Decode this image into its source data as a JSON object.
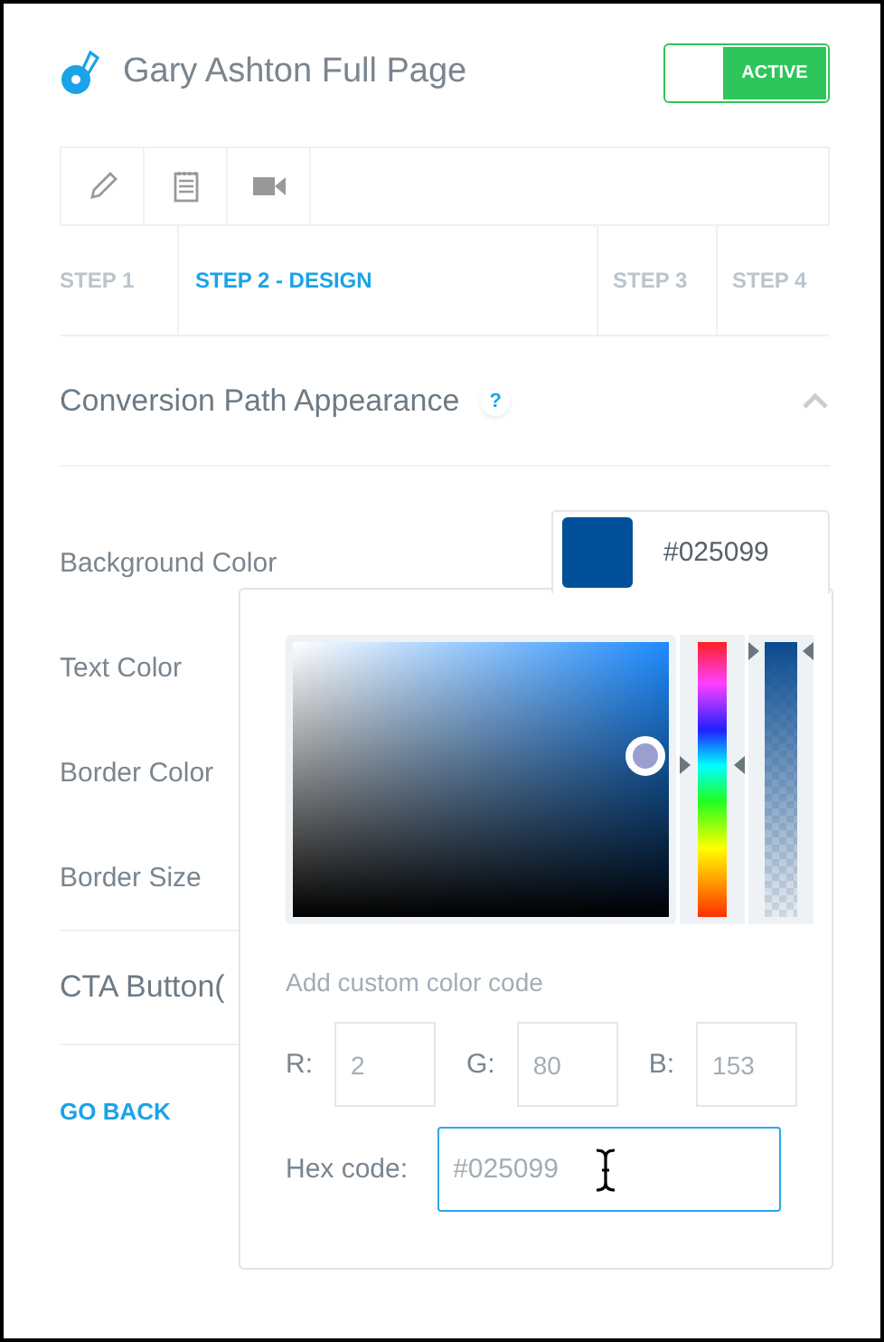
{
  "header": {
    "title": "Gary Ashton Full Page",
    "toggle": {
      "label": "ACTIVE",
      "on": true
    }
  },
  "toolbar": [
    {
      "kind": "pencil"
    },
    {
      "kind": "notepad"
    },
    {
      "kind": "video"
    }
  ],
  "steps": [
    {
      "label": "STEP 1",
      "selected": false
    },
    {
      "label": "STEP 2 - DESIGN",
      "selected": true
    },
    {
      "label": "STEP 3",
      "selected": false
    },
    {
      "label": "STEP 4",
      "selected": false
    }
  ],
  "section": {
    "title": "Conversion Path Appearance",
    "help": "?",
    "expanded": true
  },
  "fields": [
    {
      "label": "Background Color",
      "swatch": {
        "color": "#025099",
        "value": "#025099"
      }
    },
    {
      "label": "Text Color"
    },
    {
      "label": "Border Color"
    },
    {
      "label": "Border Size"
    }
  ],
  "next_section": {
    "title": "CTA Button("
  },
  "go_back": "GO BACK",
  "picker": {
    "opacity": {
      "level": 1
    },
    "custom_label": "Add custom color code",
    "rgb": [
      {
        "label": "R:",
        "value": "2"
      },
      {
        "label": "G:",
        "value": "80"
      },
      {
        "label": "B:",
        "value": "153"
      }
    ],
    "hex": {
      "label": "Hex code:",
      "value": "#025099"
    }
  }
}
